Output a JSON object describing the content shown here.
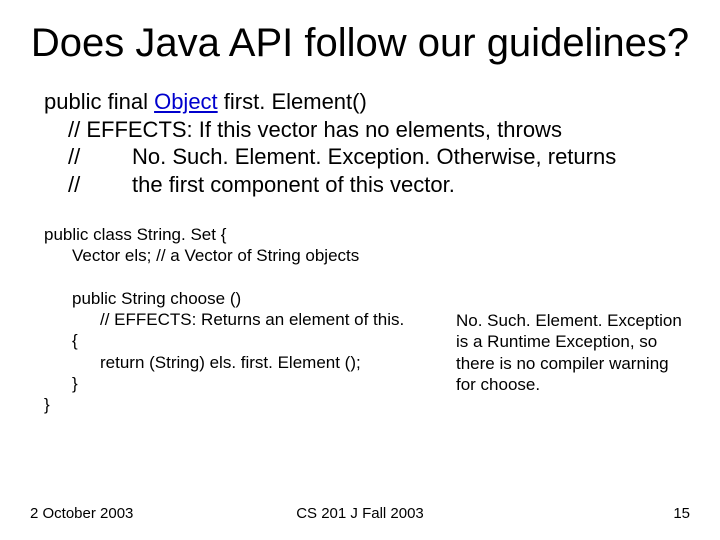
{
  "title": "Does Java API follow our guidelines?",
  "spec": {
    "sig_pre": "public final ",
    "sig_link": "Object",
    "sig_post": " first. Element()",
    "line1": "// EFFECTS:  If this vector has no elements, throws",
    "line2_s": "//",
    "line2_t": "No. Such. Element. Exception.  Otherwise, returns",
    "line3_s": "//",
    "line3_t": "the first component of this vector."
  },
  "code": {
    "l0": "public class String. Set {",
    "l1": "Vector els; // a Vector of String objects",
    "l2": "",
    "l3": "public String choose ()",
    "l4": "// EFFECTS: Returns an element of this.",
    "l5": "{",
    "l6": "return (String) els. first. Element ();",
    "l7": "}",
    "l8": "}"
  },
  "note": "No. Such. Element. Exception is a Runtime Exception, so there is no compiler warning for choose.",
  "footer": {
    "left": "2 October 2003",
    "center": "CS 201 J Fall 2003",
    "right": "15"
  }
}
